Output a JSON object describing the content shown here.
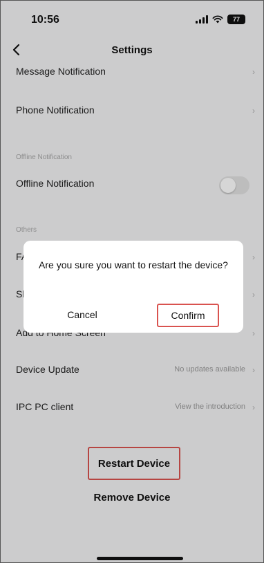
{
  "status_bar": {
    "time": "10:56",
    "battery": "77"
  },
  "nav": {
    "title": "Settings"
  },
  "rows": {
    "message_notification": {
      "label": "Message Notification"
    },
    "phone_notification": {
      "label": "Phone Notification"
    },
    "offline_section_label": "Offline Notification",
    "offline_notification": {
      "label": "Offline Notification",
      "toggle_on": false
    },
    "others_section_label": "Others",
    "faq": {
      "label": "FAQ"
    },
    "share": {
      "label": "Share"
    },
    "add_home": {
      "label": "Add to Home Screen"
    },
    "device_update": {
      "label": "Device Update",
      "value": "No updates available"
    },
    "ipc_pc_client": {
      "label": "IPC PC client",
      "value": "View the introduction"
    }
  },
  "actions": {
    "restart_label": "Restart Device",
    "remove_label": "Remove Device"
  },
  "dialog": {
    "message": "Are you sure you want to restart the device?",
    "cancel_label": "Cancel",
    "confirm_label": "Confirm"
  },
  "colors": {
    "highlight": "#d9534f",
    "background": "#f3f3f5",
    "text": "#111111"
  }
}
